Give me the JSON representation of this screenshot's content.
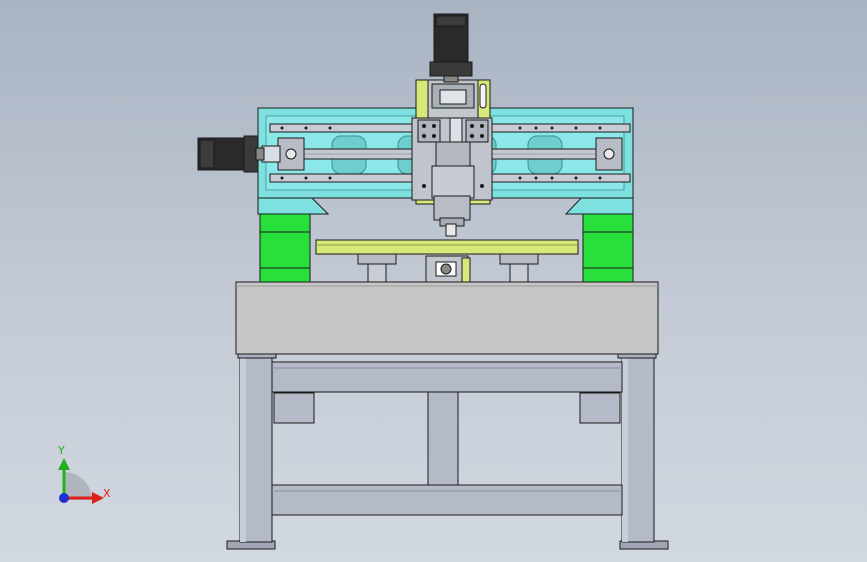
{
  "view": {
    "background_top": "#a9b3c2",
    "background_bottom": "#d2d8e0"
  },
  "colors": {
    "gantry": "#7fe0e0",
    "side_blocks": "#28e03c",
    "table": "#d6e87a",
    "spindle_carriage": "#d6e87a",
    "motor": "#2a2a2a",
    "frame_steel": "#b4bac8",
    "base_plate": "#c6c6c6",
    "rail": "#c8ccd4"
  },
  "triad": {
    "x_label": "X",
    "y_label": "Y",
    "x_color": "#e0201c",
    "y_color": "#20b020",
    "z_color": "#2030d0"
  }
}
